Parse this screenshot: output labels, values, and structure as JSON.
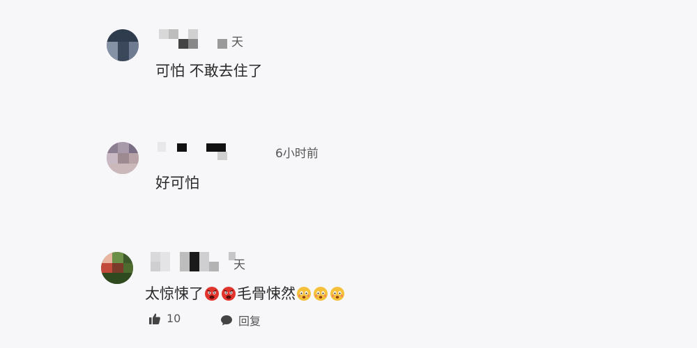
{
  "comments": [
    {
      "username": "",
      "time": "天",
      "text": "可怕 不敢去住了"
    },
    {
      "username": "",
      "time": "6小时前",
      "text": "好可怕"
    },
    {
      "username": "",
      "time": "天",
      "text_part1": "太惊悚了",
      "text_part2": "毛骨悚然",
      "emojis": [
        "angry-face-emoji",
        "angry-face-emoji",
        "worried-face-emoji",
        "worried-face-emoji",
        "worried-face-emoji"
      ],
      "like_count": "10",
      "reply_label": "回复"
    }
  ],
  "colors": {
    "background": "#f7f7f9",
    "text": "#2a2a2a",
    "meta": "#555555"
  }
}
